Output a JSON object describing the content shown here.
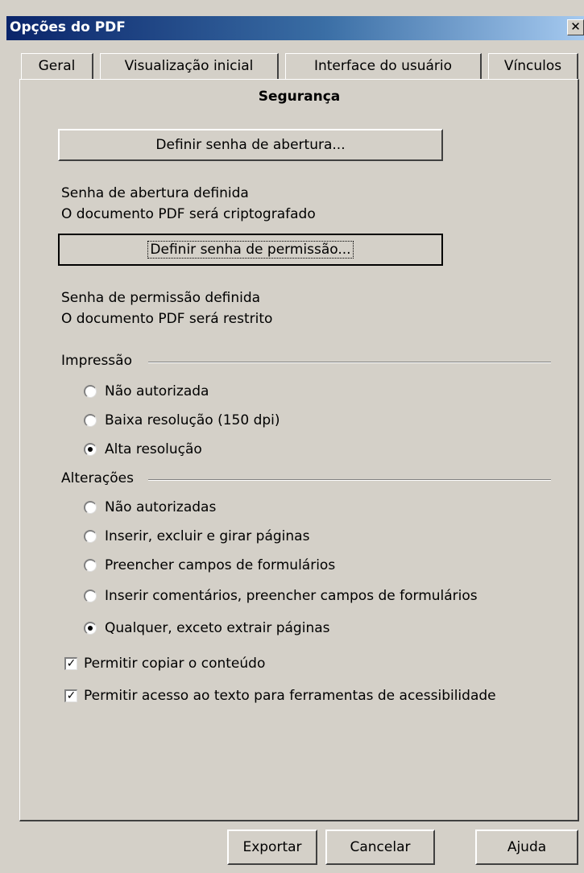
{
  "window": {
    "title": "Opções do PDF",
    "close_glyph": "✕"
  },
  "tabs": [
    {
      "label": "Geral"
    },
    {
      "label": "Visualização inicial"
    },
    {
      "label": "Interface do usuário"
    },
    {
      "label": "Vínculos"
    }
  ],
  "section_title": "Segurança",
  "open_password": {
    "button_label": "Definir senha de abertura...",
    "status_line1": "Senha de abertura definida",
    "status_line2": "O documento PDF será criptografado"
  },
  "permission_password": {
    "button_label": "Definir senha de permissão...",
    "status_line1": "Senha de permissão definida",
    "status_line2": "O documento PDF será restrito"
  },
  "printing": {
    "label": "Impressão",
    "options": [
      {
        "label": "Não autorizada",
        "selected": false
      },
      {
        "label": "Baixa resolução (150 dpi)",
        "selected": false
      },
      {
        "label": "Alta resolução",
        "selected": true
      }
    ]
  },
  "changes": {
    "label": "Alterações",
    "options": [
      {
        "label": "Não autorizadas",
        "selected": false
      },
      {
        "label": "Inserir, excluir e girar páginas",
        "selected": false
      },
      {
        "label": "Preencher campos de formulários",
        "selected": false
      },
      {
        "label": "Inserir comentários, preencher campos de formulários",
        "selected": false
      },
      {
        "label": "Qualquer, exceto extrair páginas",
        "selected": true
      }
    ]
  },
  "checkboxes": [
    {
      "label": "Permitir copiar o conteúdo",
      "checked": true
    },
    {
      "label": "Permitir acesso ao texto para ferramentas de acessibilidade",
      "checked": true
    }
  ],
  "footer": {
    "export_label": "Exportar",
    "cancel_label": "Cancelar",
    "help_label": "Ajuda"
  }
}
